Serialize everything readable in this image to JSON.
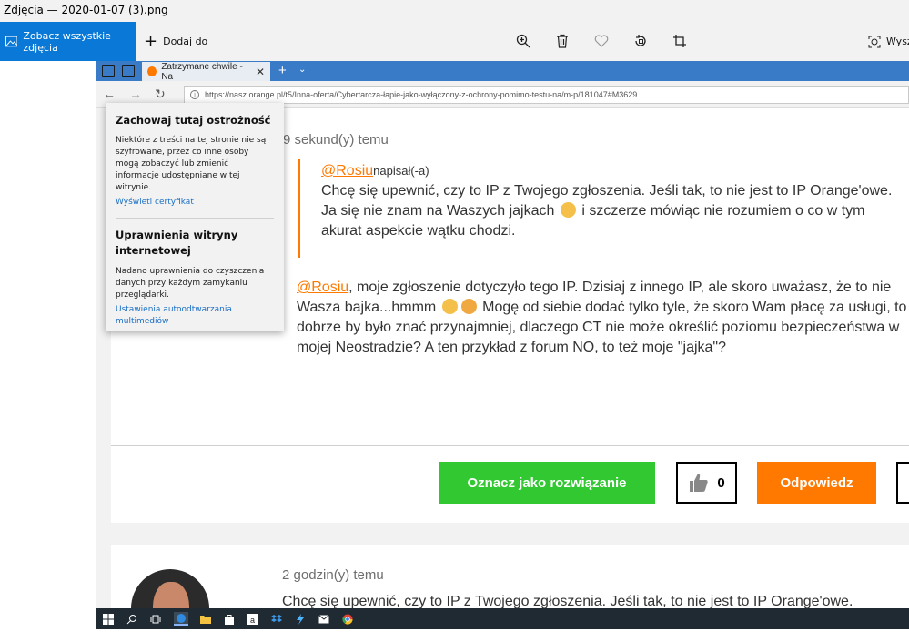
{
  "window": {
    "title": "Zdjęcia — 2020-01-07 (3).png"
  },
  "toolbar": {
    "see_all_label": "Zobacz wszystkie zdjęcia",
    "add_to_label": "Dodaj do",
    "search_label": "Wysz",
    "icons": [
      "zoom-in-icon",
      "delete-icon",
      "favorite-heart-icon",
      "rotate-icon",
      "crop-icon",
      "select-icon"
    ]
  },
  "browser": {
    "tab_title": "Zatrzymane chwile - Na",
    "new_tab": "+",
    "tab_list": "⌄",
    "url": "https://nasz.orange.pl/t5/Inna-oferta/Cybertarcza-łapie-jako-wyłączony-z-ochrony-pomimo-testu-na/m-p/181047#M3629"
  },
  "flyout": {
    "title": "Zachowaj tutaj ostrożność",
    "text": "Niektóre z treści na tej stronie nie są szyfrowane, przez co inne osoby mogą zobaczyć lub zmienić informacje udostępniane w tej witrynie.",
    "cert_link": "Wyświetl certyfikat",
    "perm_title": "Uprawnienia witryny internetowej",
    "perm_text": "Nadano uprawnienia do czyszczenia danych przy każdym zamykaniu przeglądarki.",
    "autoplay_link": "Ustawienia autoodtwarzania multimediów"
  },
  "post": {
    "time": "9 sekund(y) temu",
    "quote_author": "@Rosiu",
    "quote_wrote": "napisał(-a)",
    "quote_line1": "Chcę się upewnić, czy to IP z Twojego zgłoszenia. Jeśli tak, to nie jest to IP Orange'owe.",
    "quote_line2a": "Ja się nie znam na Waszych jajkach",
    "quote_line2b": "i szczerze mówiąc nie rozumiem o co w tym akurat aspekcie wątku chodzi.",
    "reply_mention": "@Rosiu",
    "reply_part1": ", moje zgłoszenie dotyczyło tego IP. Dzisiaj z innego IP, ale skoro uważasz, że to nie Wasza bajka...hmmm",
    "reply_part2": "Mogę od siebie dodać tylko tyle, że skoro Wam płacę za usługi, to dobrze by było znać przynajmniej, dlaczego CT nie może określić poziomu bezpieczeństwa w mojej Neostradzie? A ten przykład z forum NO, to też moje \"jajka\"?",
    "btn_solution": "Oznacz jako rozwiązanie",
    "kudos_count": "0",
    "btn_reply": "Odpowiedz"
  },
  "post2": {
    "time": "2 godzin(y) temu",
    "text": "Chcę się upewnić, czy to IP z Twojego zgłoszenia. Jeśli tak, to nie jest to IP Orange'owe."
  },
  "colors": {
    "accent_blue": "#0a78d7",
    "orange": "#ff7900",
    "green": "#32c832",
    "edge_blue": "#3a7bc8"
  }
}
